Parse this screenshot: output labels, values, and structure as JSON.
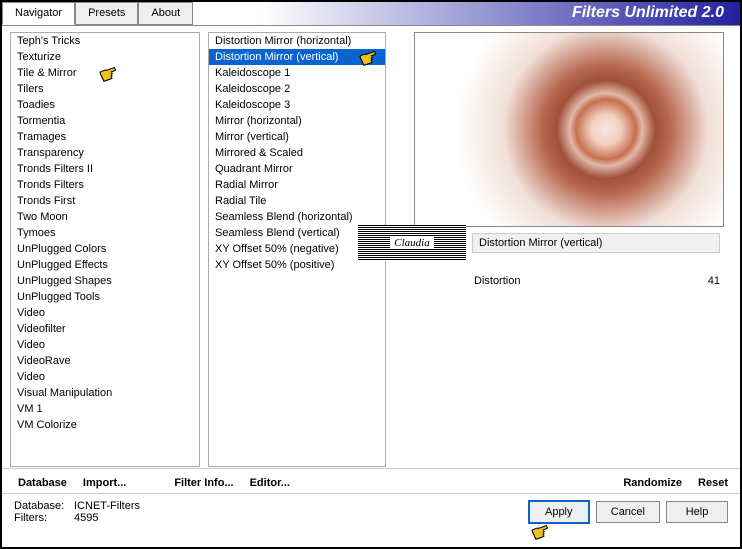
{
  "title": "Filters Unlimited 2.0",
  "tabs": {
    "navigator": "Navigator",
    "presets": "Presets",
    "about": "About"
  },
  "categories": [
    "Teph's Tricks",
    "Texturize",
    "Tile & Mirror",
    "Tilers",
    "Toadies",
    "Tormentia",
    "Tramages",
    "Transparency",
    "Tronds Filters II",
    "Tronds Filters",
    "Tronds First",
    "Two Moon",
    "Tymoes",
    "UnPlugged Colors",
    "UnPlugged Effects",
    "UnPlugged Shapes",
    "UnPlugged Tools",
    "Video",
    "Videofilter",
    "Video",
    "VideoRave",
    "Video",
    "Visual Manipulation",
    "VM 1",
    "VM Colorize"
  ],
  "filters": [
    "Distortion Mirror (horizontal)",
    "Distortion Mirror (vertical)",
    "Kaleidoscope 1",
    "Kaleidoscope 2",
    "Kaleidoscope 3",
    "Mirror (horizontal)",
    "Mirror (vertical)",
    "Mirrored & Scaled",
    "Quadrant Mirror",
    "Radial Mirror",
    "Radial Tile",
    "Seamless Blend (horizontal)",
    "Seamless Blend (vertical)",
    "XY Offset 50% (negative)",
    "XY Offset 50% (positive)"
  ],
  "selected_filter": "Distortion Mirror (vertical)",
  "watermark": "Claudia",
  "param": {
    "label": "Distortion",
    "value": "41"
  },
  "buttons": {
    "database": "Database",
    "import": "Import...",
    "filter_info": "Filter Info...",
    "editor": "Editor...",
    "randomize": "Randomize",
    "reset": "Reset",
    "apply": "Apply",
    "cancel": "Cancel",
    "help": "Help"
  },
  "info": {
    "db_label": "Database:",
    "db_value": "ICNET-Filters",
    "filters_label": "Filters:",
    "filters_value": "4595"
  }
}
